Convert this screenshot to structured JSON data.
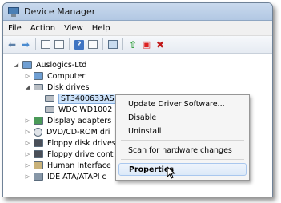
{
  "window": {
    "title": "Device Manager"
  },
  "menu": [
    "File",
    "Action",
    "View",
    "Help"
  ],
  "toolbar": {
    "icons": [
      "back-arrow-icon",
      "forward-arrow-icon",
      "show-hide-tree-icon",
      "properties-icon",
      "help-icon",
      "view-icon",
      "scan-hardware-icon",
      "update-driver-icon",
      "disable-device-icon",
      "uninstall-device-icon"
    ],
    "help_glyph": "?"
  },
  "tree": {
    "root": "Auslogics-Ltd",
    "items": [
      {
        "label": "Computer",
        "expander": "▷"
      },
      {
        "label": "Disk drives",
        "expander": "◢"
      },
      {
        "label": "ST3400633AS ATA Device",
        "child": true,
        "selected": true
      },
      {
        "label": "WDC WD1002",
        "child": true
      },
      {
        "label": "Display adapters",
        "expander": "▷"
      },
      {
        "label": "DVD/CD-ROM dri",
        "expander": "▷"
      },
      {
        "label": "Floppy disk drives",
        "expander": "▷"
      },
      {
        "label": "Floppy drive cont",
        "expander": "▷"
      },
      {
        "label": "Human Interface",
        "expander": "▷"
      },
      {
        "label": "IDE ATA/ATAPI c",
        "expander": "▷"
      }
    ]
  },
  "context_menu": {
    "items": [
      "Update Driver Software...",
      "Disable",
      "Uninstall",
      "Scan for hardware changes",
      "Properties"
    ],
    "highlighted": "Properties"
  },
  "colors": {
    "selection": "#cde3fb",
    "title_bar": "#b2c8e3",
    "highlight_border": "#a9c7ee"
  }
}
